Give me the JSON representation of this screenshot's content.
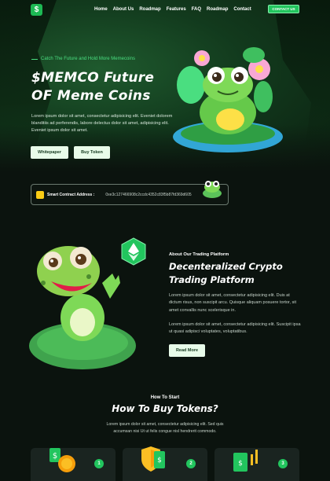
{
  "brand": {
    "logo_glyph": "$"
  },
  "nav": {
    "items": [
      "Home",
      "About Us",
      "Roadmap",
      "Features",
      "FAQ",
      "Roadmap",
      "Contact"
    ],
    "contact_button": "CONTACT US"
  },
  "hero": {
    "tagline": "Catch The Future and Hold More Memecoins",
    "title_line1": "$MEMCO Future",
    "title_line2": "OF Meme Coins",
    "description": "Lorem ipsum dolor sit amet, consectetur adipisicing elit. Eveniet dolorem blanditiis ad perferendis, labore delectus dolor sit amet, adipisicing elit. Eveniet ipsum dolor sit amet.",
    "whitepaper_button": "Whitepaper",
    "buy_button": "Buy Token"
  },
  "contract": {
    "label": "Smart Contract Address :",
    "address": "0xe3c127466908c2ccdc4352c83f5b87fd369d605"
  },
  "trading": {
    "eyebrow": "About Our Trading Platform",
    "title_line1": "Decenteralized Crypto",
    "title_line2": "Trading Platform",
    "paragraph1": "Lorem ipsum dolor sit amet, consectetur adipisicing elit. Duis at dictum risus, non suscipit arcu. Quisque aliquam posuere tortor, sit amet convallis nunc scelerisque in.",
    "paragraph2": "Lorem ipsum dolor sit amet, consectetur adipisicing elit. Suscipit ipsa ut quasi adipisci voluptates, voluptatibus.",
    "readmore_button": "Read More"
  },
  "howto": {
    "eyebrow": "How To Start",
    "title": "How To Buy Tokens?",
    "description": "Lorem ipsum dolor sit amet, consectetur adipisicing elit. Sed quis accumsan nisi Ut ut felis congue nisl hendrerit commodo.",
    "steps": [
      "1",
      "2",
      "3"
    ]
  },
  "colors": {
    "accent": "#22c55e",
    "background": "#0b130e",
    "button_light": "#e8fbe9"
  }
}
